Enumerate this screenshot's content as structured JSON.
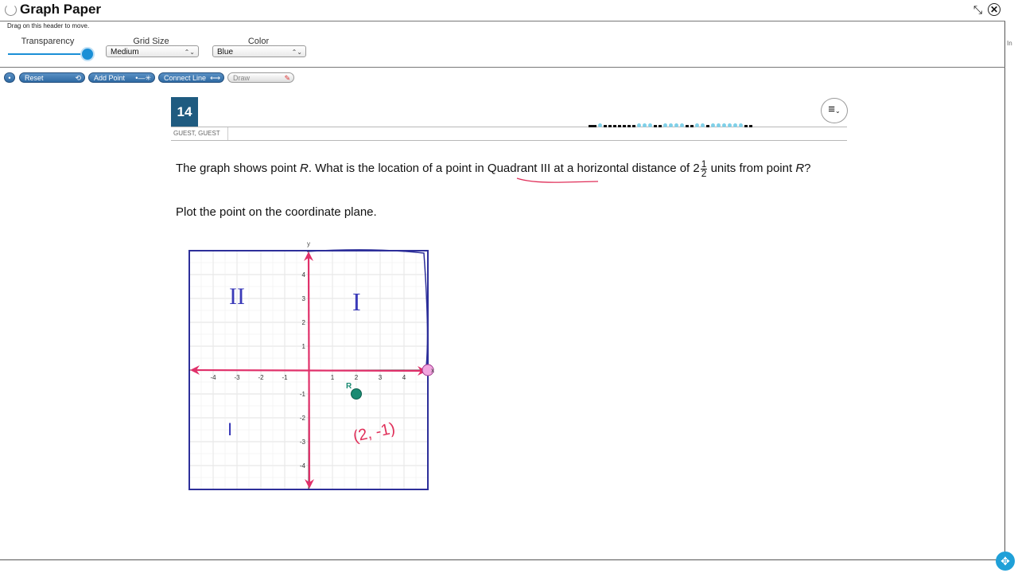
{
  "tool": {
    "title": "Graph Paper",
    "drag_hint": "Drag on this header to move.",
    "minimize_icon": "shrink-arrows-icon",
    "close_icon": "close-circle-icon"
  },
  "controls": {
    "transparency_label": "Transparency",
    "transparency_value": 1.0,
    "grid_size_label": "Grid Size",
    "grid_size_value": "Medium",
    "color_label": "Color",
    "color_value": "Blue"
  },
  "toolbar": {
    "reset_label": "Reset",
    "add_point_label": "Add Point",
    "connect_line_label": "Connect Line",
    "draw_label": "Draw"
  },
  "question": {
    "number": "14",
    "user": "GUEST, GUEST",
    "text_before": "The graph shows point ",
    "point_name": "R",
    "text_middle": ". What is the location of a point in Quadrant III at a horizontal distance of 2",
    "frac_num": "1",
    "frac_den": "2",
    "text_after": " units from point ",
    "point_name2": "R",
    "text_end": "?",
    "instruction": "Plot the point on the coordinate plane."
  },
  "graph": {
    "x_label": "x",
    "y_label": "y",
    "x_ticks": [
      "-4",
      "-3",
      "-2",
      "-1",
      "1",
      "2",
      "3",
      "4"
    ],
    "y_ticks": [
      "4",
      "3",
      "2",
      "1",
      "-1",
      "-2",
      "-3",
      "-4"
    ],
    "point_label": "R",
    "point_x": 2,
    "point_y": -1,
    "annotation_q2": "II",
    "annotation_q1": "I",
    "annotation_coords": "(2, -1)",
    "annotation_q3": "I",
    "colors": {
      "axis": "#e0306a",
      "frame": "#2d2f9a",
      "point": "#1a8a72",
      "ink_blue": "#3a3ab8",
      "ink_red": "#e0305a"
    }
  },
  "side_fragment": "In"
}
